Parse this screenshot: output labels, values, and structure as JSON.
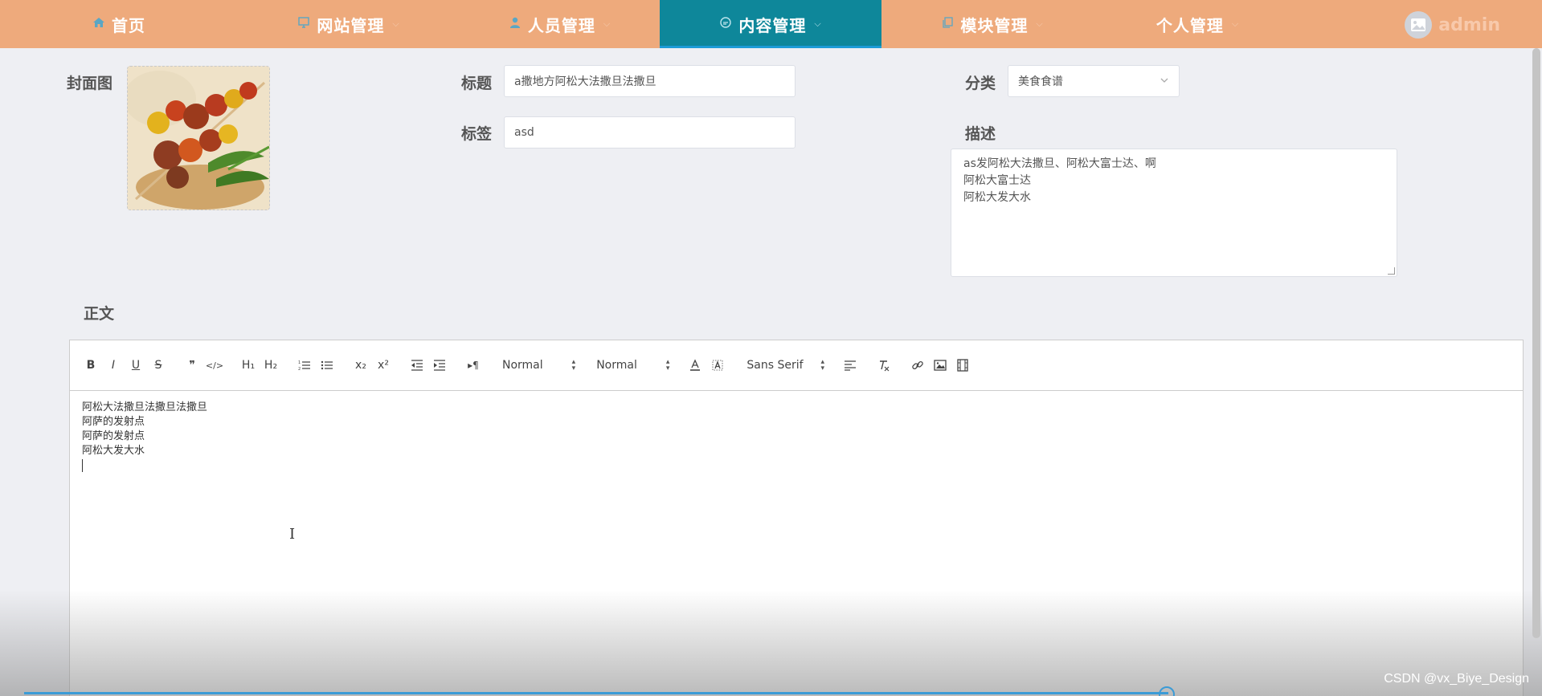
{
  "nav": {
    "items": [
      {
        "label": "首页",
        "icon": "home-icon",
        "active": false
      },
      {
        "label": "网站管理",
        "icon": "monitor-icon",
        "active": false
      },
      {
        "label": "人员管理",
        "icon": "user-icon",
        "active": false
      },
      {
        "label": "内容管理",
        "icon": "chat-icon",
        "active": true
      },
      {
        "label": "模块管理",
        "icon": "copy-icon",
        "active": false
      },
      {
        "label": "个人管理",
        "icon": "",
        "active": false
      }
    ],
    "user": "admin"
  },
  "form": {
    "cover_label": "封面图",
    "title_label": "标题",
    "title_value": "a撒地方阿松大法撒旦法撒旦",
    "category_label": "分类",
    "category_value": "美食食谱",
    "tags_label": "标签",
    "tags_value": "asd",
    "desc_label": "描述",
    "desc_lines": [
      "as发阿松大法撒旦、阿松大富士达、啊",
      "阿松大富士达",
      "阿松大发大水"
    ],
    "body_label": "正文"
  },
  "toolbar": {
    "bold": "B",
    "italic": "I",
    "underline": "U",
    "strike": "S",
    "quote": "❞",
    "code": "</>",
    "h1": "H₁",
    "h2": "H₂",
    "subscript": "x₂",
    "superscript": "x²",
    "direction": "▸¶",
    "size_select": "Normal",
    "header_select": "Normal",
    "font_select": "Sans Serif"
  },
  "editor": {
    "lines": [
      "阿松大法撒旦法撒旦法撒旦",
      "阿萨的发射点",
      "阿萨的发射点",
      "阿松大发大水"
    ]
  },
  "watermark": "CSDN @vx_Biye_Design",
  "colors": {
    "nav_bg": "#eeaa7c",
    "nav_active": "#0e879a",
    "page_bg": "#eeeff3"
  }
}
